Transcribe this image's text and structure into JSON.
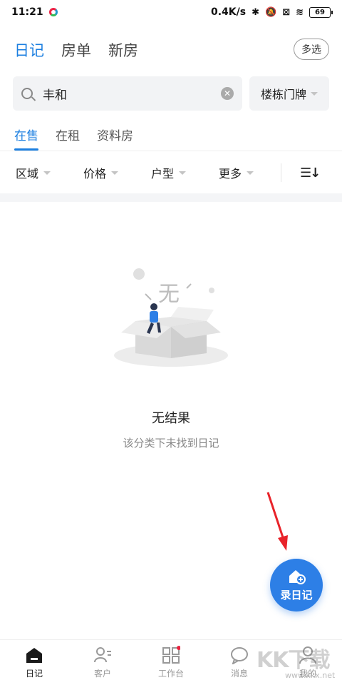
{
  "status_bar": {
    "time": "11:21",
    "speed": "0.4K/s",
    "battery": "69"
  },
  "header": {
    "tabs": [
      {
        "label": "日记",
        "active": true
      },
      {
        "label": "房单",
        "active": false
      },
      {
        "label": "新房",
        "active": false
      }
    ],
    "multi_select": "多选"
  },
  "search": {
    "value": "丰和",
    "building_button": "楼栋门牌"
  },
  "sub_tabs": [
    {
      "label": "在售",
      "active": true
    },
    {
      "label": "在租",
      "active": false
    },
    {
      "label": "资料房",
      "active": false
    }
  ],
  "filters": [
    {
      "label": "区域"
    },
    {
      "label": "价格"
    },
    {
      "label": "户型"
    },
    {
      "label": "更多"
    }
  ],
  "empty_state": {
    "illustration_text": "无",
    "title": "无结果",
    "subtitle": "该分类下未找到日记"
  },
  "fab": {
    "label": "录日记"
  },
  "bottom_nav": [
    {
      "label": "日记",
      "active": true,
      "icon": "home-icon"
    },
    {
      "label": "客户",
      "active": false,
      "icon": "customer-icon"
    },
    {
      "label": "工作台",
      "active": false,
      "icon": "grid-icon",
      "badge": true
    },
    {
      "label": "消息",
      "active": false,
      "icon": "chat-icon"
    },
    {
      "label": "我的",
      "active": false,
      "icon": "user-icon"
    }
  ],
  "watermark": {
    "text": "KK下载",
    "url": "www.kkx.net"
  },
  "colors": {
    "accent": "#1c7fe0",
    "fab": "#2d7fe6",
    "arrow": "#e8232a"
  }
}
